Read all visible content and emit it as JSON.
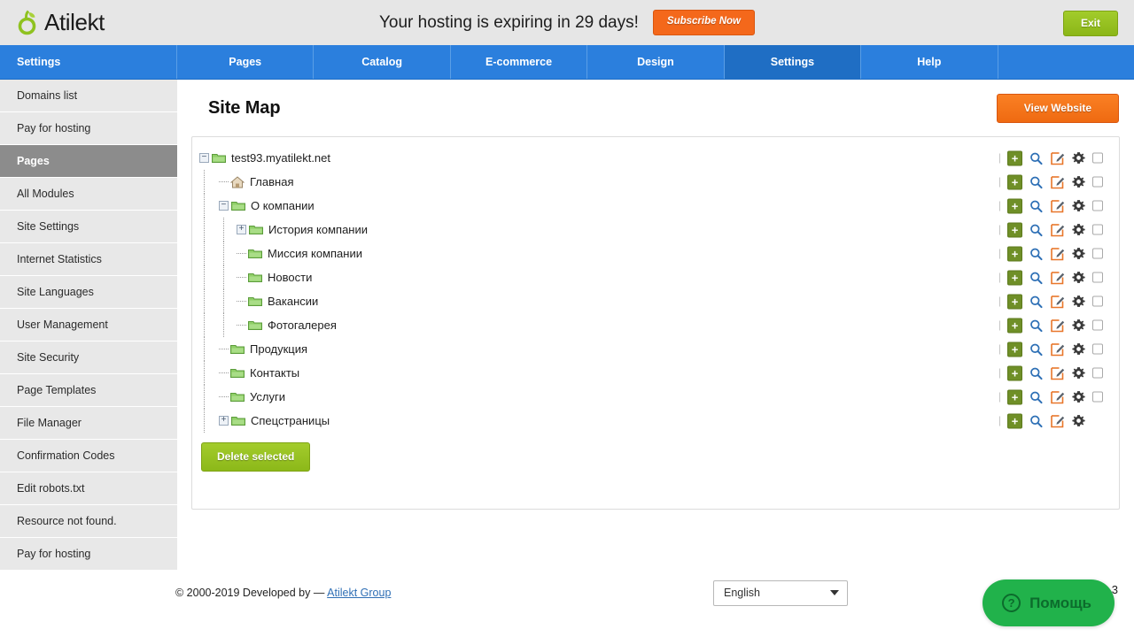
{
  "brand": {
    "name": "Atilekt",
    "logo_icon": "atilekt-leaf-logo",
    "accent_green": "#95c11f",
    "accent_orange": "#f4731b",
    "accent_blue": "#2b7fdd"
  },
  "banner": {
    "message": "Your hosting is expiring in 29 days!",
    "subscribe_label": "Subscribe Now",
    "exit_label": "Exit"
  },
  "mainnav": {
    "brand_cell": "Settings",
    "items": [
      {
        "label": "Pages",
        "active": false
      },
      {
        "label": "Catalog",
        "active": false
      },
      {
        "label": "E-commerce",
        "active": false
      },
      {
        "label": "Design",
        "active": false
      },
      {
        "label": "Settings",
        "active": true
      },
      {
        "label": "Help",
        "active": false
      }
    ]
  },
  "sidebar": {
    "items": [
      {
        "label": "Domains list",
        "active": false
      },
      {
        "label": "Pay for hosting",
        "active": false
      },
      {
        "label": "Pages",
        "active": true
      },
      {
        "label": "All Modules",
        "active": false
      },
      {
        "label": "Site Settings",
        "active": false
      },
      {
        "label": "Internet Statistics",
        "active": false
      },
      {
        "label": "Site Languages",
        "active": false
      },
      {
        "label": "User Management",
        "active": false
      },
      {
        "label": "Site Security",
        "active": false
      },
      {
        "label": "Page Templates",
        "active": false
      },
      {
        "label": "File Manager",
        "active": false
      },
      {
        "label": "Confirmation Codes",
        "active": false
      },
      {
        "label": "Edit robots.txt",
        "active": false
      },
      {
        "label": "Resource not found.",
        "active": false
      },
      {
        "label": "Pay for hosting",
        "active": false
      }
    ]
  },
  "main": {
    "page_title": "Site Map",
    "view_website_label": "View Website",
    "delete_selected_label": "Delete selected"
  },
  "tree": {
    "nodes": [
      {
        "label": "test93.myatilekt.net",
        "level": 0,
        "toggle": "minus",
        "icon": "folder-icon",
        "has_checkbox": true
      },
      {
        "label": "Главная",
        "level": 1,
        "toggle": "none",
        "icon": "home-icon",
        "has_checkbox": true
      },
      {
        "label": "О компании",
        "level": 1,
        "toggle": "minus",
        "icon": "folder-icon",
        "has_checkbox": true
      },
      {
        "label": "История компании",
        "level": 2,
        "toggle": "plus",
        "icon": "folder-icon",
        "has_checkbox": true
      },
      {
        "label": "Миссия компании",
        "level": 2,
        "toggle": "none",
        "icon": "folder-icon",
        "has_checkbox": true
      },
      {
        "label": "Новости",
        "level": 2,
        "toggle": "none",
        "icon": "folder-icon",
        "has_checkbox": true
      },
      {
        "label": "Вакансии",
        "level": 2,
        "toggle": "none",
        "icon": "folder-icon",
        "has_checkbox": true
      },
      {
        "label": "Фотогалерея",
        "level": 2,
        "toggle": "none",
        "icon": "folder-icon",
        "has_checkbox": true
      },
      {
        "label": "Продукция",
        "level": 1,
        "toggle": "none",
        "icon": "folder-icon",
        "has_checkbox": true
      },
      {
        "label": "Контакты",
        "level": 1,
        "toggle": "none",
        "icon": "folder-icon",
        "has_checkbox": true
      },
      {
        "label": "Услуги",
        "level": 1,
        "toggle": "none",
        "icon": "folder-icon",
        "has_checkbox": true
      },
      {
        "label": "Спецстраницы",
        "level": 1,
        "toggle": "plus",
        "icon": "folder-icon",
        "has_checkbox": false
      }
    ],
    "row_actions": [
      "add-page-icon",
      "preview-icon",
      "edit-icon",
      "settings-gear-icon",
      "row-checkbox"
    ],
    "add_label": "+"
  },
  "footer": {
    "copyright_prefix": "© 2000-2019 Developed by — ",
    "copyright_link": "Atilekt Group",
    "language_value": "English"
  },
  "help_widget": {
    "label": "Помощь",
    "icon": "question-mark-icon",
    "badge": "3"
  }
}
